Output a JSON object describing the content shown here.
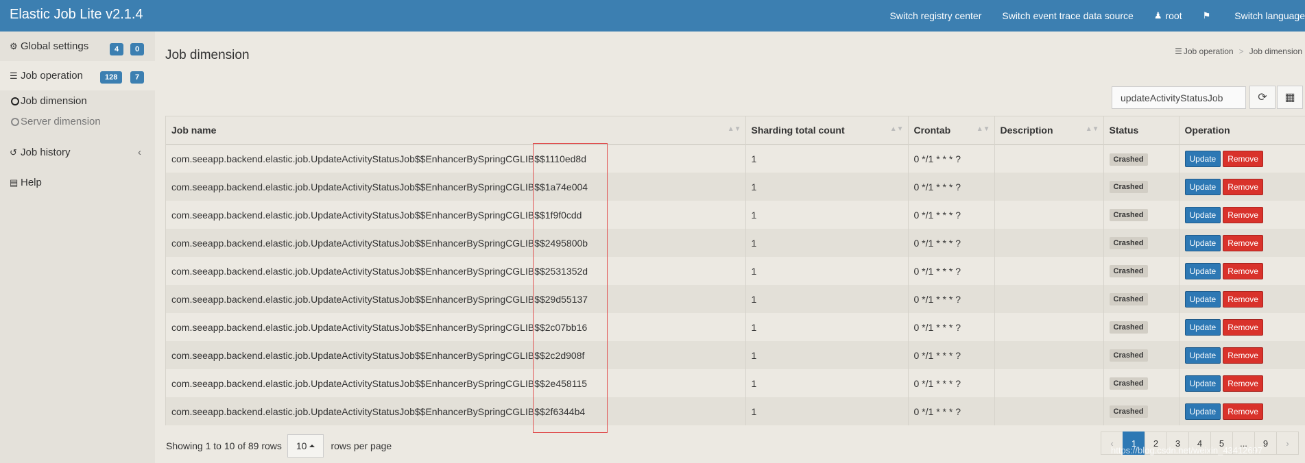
{
  "header": {
    "brand": "Elastic Job Lite v2.1.4",
    "switch_registry": "Switch registry center",
    "switch_event": "Switch event trace data source",
    "user": "root",
    "switch_language": "Switch language"
  },
  "sidebar": {
    "global_settings": {
      "label": "Global settings",
      "badge1": "4",
      "badge2": "0"
    },
    "job_operation": {
      "label": "Job operation",
      "badge1": "128",
      "badge2": "7"
    },
    "job_dimension": "Job dimension",
    "server_dimension": "Server dimension",
    "job_history": "Job history",
    "help": "Help"
  },
  "page": {
    "title": "Job dimension",
    "breadcrumb_parent": "Job operation",
    "breadcrumb_current": "Job dimension"
  },
  "search": {
    "value": "updateActivityStatusJob"
  },
  "table": {
    "headers": {
      "job_name": "Job name",
      "sharding": "Sharding total count",
      "crontab": "Crontab",
      "description": "Description",
      "status": "Status",
      "operation": "Operation"
    },
    "update_label": "Update",
    "remove_label": "Remove",
    "rows": [
      {
        "job_name": "com.seeapp.backend.elastic.job.UpdateActivityStatusJob$$EnhancerBySpringCGLIB$$1110ed8d",
        "sharding": "1",
        "crontab": "0 */1 * * * ?",
        "description": "",
        "status": "Crashed"
      },
      {
        "job_name": "com.seeapp.backend.elastic.job.UpdateActivityStatusJob$$EnhancerBySpringCGLIB$$1a74e004",
        "sharding": "1",
        "crontab": "0 */1 * * * ?",
        "description": "",
        "status": "Crashed"
      },
      {
        "job_name": "com.seeapp.backend.elastic.job.UpdateActivityStatusJob$$EnhancerBySpringCGLIB$$1f9f0cdd",
        "sharding": "1",
        "crontab": "0 */1 * * * ?",
        "description": "",
        "status": "Crashed"
      },
      {
        "job_name": "com.seeapp.backend.elastic.job.UpdateActivityStatusJob$$EnhancerBySpringCGLIB$$2495800b",
        "sharding": "1",
        "crontab": "0 */1 * * * ?",
        "description": "",
        "status": "Crashed"
      },
      {
        "job_name": "com.seeapp.backend.elastic.job.UpdateActivityStatusJob$$EnhancerBySpringCGLIB$$2531352d",
        "sharding": "1",
        "crontab": "0 */1 * * * ?",
        "description": "",
        "status": "Crashed"
      },
      {
        "job_name": "com.seeapp.backend.elastic.job.UpdateActivityStatusJob$$EnhancerBySpringCGLIB$$29d55137",
        "sharding": "1",
        "crontab": "0 */1 * * * ?",
        "description": "",
        "status": "Crashed"
      },
      {
        "job_name": "com.seeapp.backend.elastic.job.UpdateActivityStatusJob$$EnhancerBySpringCGLIB$$2c07bb16",
        "sharding": "1",
        "crontab": "0 */1 * * * ?",
        "description": "",
        "status": "Crashed"
      },
      {
        "job_name": "com.seeapp.backend.elastic.job.UpdateActivityStatusJob$$EnhancerBySpringCGLIB$$2c2d908f",
        "sharding": "1",
        "crontab": "0 */1 * * * ?",
        "description": "",
        "status": "Crashed"
      },
      {
        "job_name": "com.seeapp.backend.elastic.job.UpdateActivityStatusJob$$EnhancerBySpringCGLIB$$2e458115",
        "sharding": "1",
        "crontab": "0 */1 * * * ?",
        "description": "",
        "status": "Crashed"
      },
      {
        "job_name": "com.seeapp.backend.elastic.job.UpdateActivityStatusJob$$EnhancerBySpringCGLIB$$2f6344b4",
        "sharding": "1",
        "crontab": "0 */1 * * * ?",
        "description": "",
        "status": "Crashed"
      }
    ]
  },
  "footer": {
    "showing": "Showing 1 to 10 of 89 rows",
    "page_size": "10",
    "rows_per_page": "rows per page"
  },
  "pagination": {
    "prev": "‹",
    "pages": [
      "1",
      "2",
      "3",
      "4",
      "5",
      "...",
      "9"
    ],
    "next": "›",
    "active": "1"
  },
  "watermark": "https://blog.csdn.net/weixin_43412697"
}
